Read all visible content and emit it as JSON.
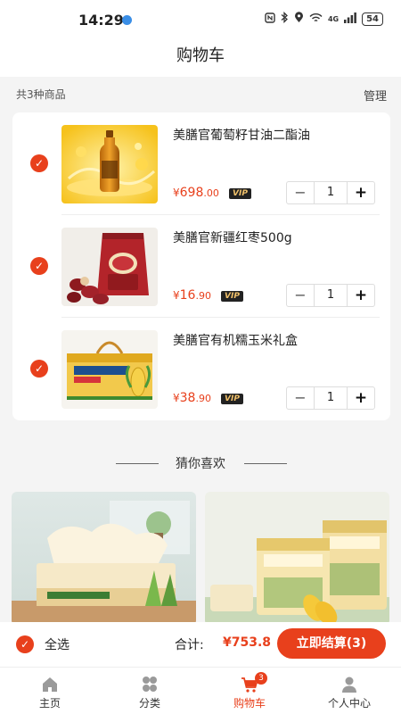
{
  "status_bar": {
    "time": "14:29",
    "network": "4G",
    "battery": "54"
  },
  "header": {
    "title": "购物车"
  },
  "summary": {
    "count_text": "共3种商品",
    "manage_label": "管理"
  },
  "cart_items": [
    {
      "name": "美膳官葡萄籽甘油二酯油",
      "price_symbol": "¥",
      "price_int": "698",
      "price_dec": ".00",
      "vip": "VIP",
      "quantity": "1",
      "minus": "−",
      "plus": "+",
      "check": "✓"
    },
    {
      "name": "美膳官新疆红枣500g",
      "price_symbol": "¥",
      "price_int": "16",
      "price_dec": ".90",
      "vip": "VIP",
      "quantity": "1",
      "minus": "−",
      "plus": "+",
      "check": "✓"
    },
    {
      "name": "美膳官有机糯玉米礼盒",
      "price_symbol": "¥",
      "price_int": "38",
      "price_dec": ".90",
      "vip": "VIP",
      "quantity": "1",
      "minus": "−",
      "plus": "+",
      "check": "✓"
    }
  ],
  "recommend": {
    "title": "猜你喜欢"
  },
  "checkout": {
    "select_all": "全选",
    "check": "✓",
    "total_label": "合计:",
    "total_value": "¥753.8",
    "pay_button": "立即结算(3)"
  },
  "tabbar": {
    "items": [
      {
        "label": "主页",
        "icon": "home-icon"
      },
      {
        "label": "分类",
        "icon": "category-icon"
      },
      {
        "label": "购物车",
        "icon": "cart-icon",
        "badge": "3"
      },
      {
        "label": "个人中心",
        "icon": "user-icon"
      }
    ]
  },
  "colors": {
    "accent": "#e8401c",
    "vip_bg": "#222222",
    "vip_text": "#f2c26b"
  }
}
